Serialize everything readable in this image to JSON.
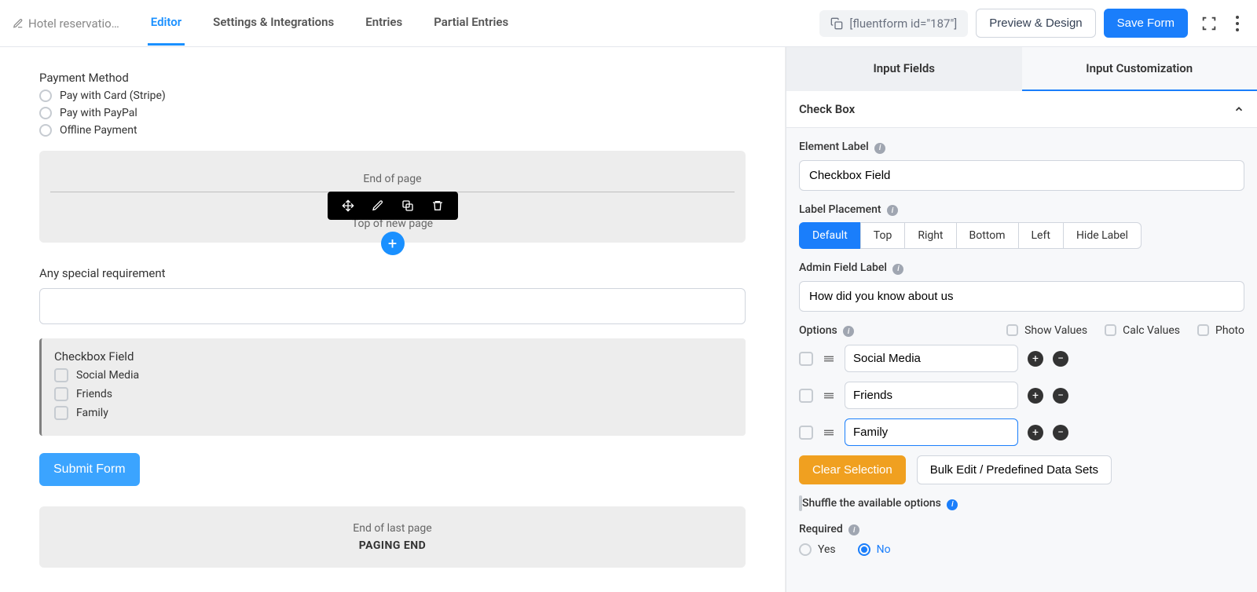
{
  "header": {
    "form_name": "Hotel reservatio…",
    "tabs": [
      "Editor",
      "Settings & Integrations",
      "Entries",
      "Partial Entries"
    ],
    "shortcode": "[fluentform id=\"187\"]",
    "preview_btn": "Preview & Design",
    "save_btn": "Save Form"
  },
  "editor": {
    "payment_label": "Payment Method",
    "payment_options": [
      "Pay with Card (Stripe)",
      "Pay with PayPal",
      "Offline Payment"
    ],
    "end_page": "End of page",
    "top_new_page": "Top of new page",
    "special_req_label": "Any special requirement",
    "checkbox_label": "Checkbox Field",
    "checkbox_items": [
      "Social Media",
      "Friends",
      "Family"
    ],
    "submit_label": "Submit Form",
    "end_last_page": "End of last page",
    "paging_end": "PAGING END"
  },
  "sidebar": {
    "tabs": [
      "Input Fields",
      "Input Customization"
    ],
    "section_title": "Check Box",
    "element_label_lbl": "Element Label",
    "element_label_val": "Checkbox Field",
    "label_placement_lbl": "Label Placement",
    "placements": [
      "Default",
      "Top",
      "Right",
      "Bottom",
      "Left",
      "Hide Label"
    ],
    "admin_label_lbl": "Admin Field Label",
    "admin_label_val": "How did you know about us",
    "options_lbl": "Options",
    "show_values": "Show Values",
    "calc_values": "Calc Values",
    "photo": "Photo",
    "options": [
      "Social Media",
      "Friends",
      "Family"
    ],
    "clear_sel": "Clear Selection",
    "bulk_edit": "Bulk Edit / Predefined Data Sets",
    "shuffle": "Shuffle the available options",
    "required_lbl": "Required",
    "yes": "Yes",
    "no": "No"
  }
}
